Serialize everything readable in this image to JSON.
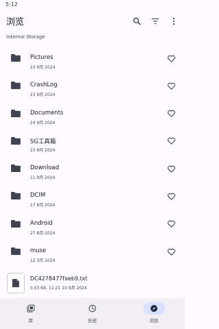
{
  "status_bar": {
    "time": "5:12"
  },
  "app_bar": {
    "title": "浏览"
  },
  "breadcrumb": "Internal Storage",
  "folders": [
    {
      "name": "Pictures",
      "date": "23 9月 2024"
    },
    {
      "name": "CrashLog",
      "date": "23 9月 2024"
    },
    {
      "name": "Documents",
      "date": "24 9月 2024"
    },
    {
      "name": "SG工具箱",
      "date": "23 9月 2024"
    },
    {
      "name": "Download",
      "date": "11 9月 2024"
    },
    {
      "name": "DCIM",
      "date": "27 8月 2024"
    },
    {
      "name": "Android",
      "date": "27 8月 2024"
    },
    {
      "name": "muse",
      "date": "12 3月 2024"
    }
  ],
  "file": {
    "name": "DC4278477faeb9.txt",
    "meta": "0.03 KB, 11:21 10 9月 2024"
  },
  "bottom_nav": [
    {
      "label": "库",
      "icon": "library-icon"
    },
    {
      "label": "历史",
      "icon": "history-icon"
    },
    {
      "label": "浏览",
      "icon": "compass-icon"
    }
  ],
  "colors": {
    "accent_pill": "#d8e2ff",
    "icon": "#3f4450",
    "nav_background": "#f2eff4"
  }
}
